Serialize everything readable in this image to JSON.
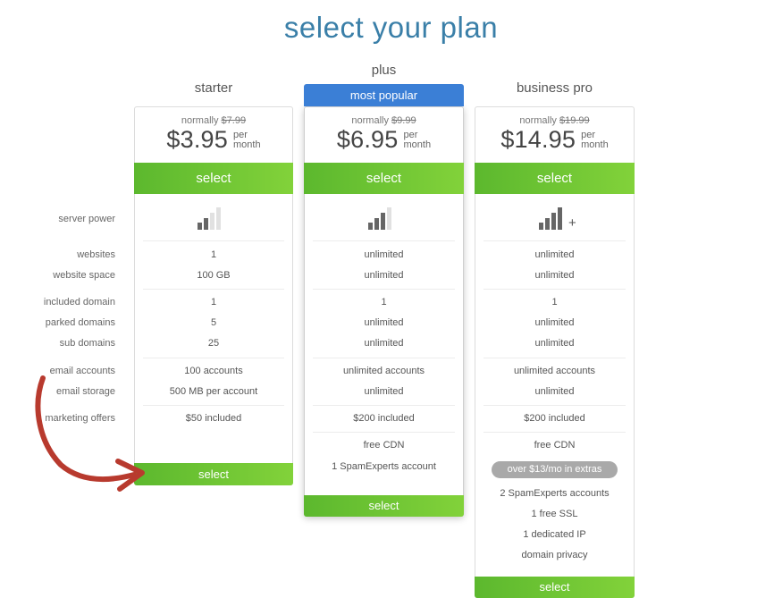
{
  "page": {
    "title": "select your plan"
  },
  "labels": {
    "server_power": "server power",
    "websites": "websites",
    "website_space": "website space",
    "included_domain": "included domain",
    "parked_domains": "parked domains",
    "sub_domains": "sub domains",
    "email_accounts": "email accounts",
    "email_storage": "email storage",
    "marketing_offers": "marketing offers"
  },
  "plans": [
    {
      "name": "starter",
      "normally_label": "normally",
      "original_price": "$7.99",
      "price": "$3.95",
      "per": "per",
      "month": "month",
      "select_top": "select",
      "select_bottom": "select",
      "server_power_level": 2,
      "websites": "1",
      "website_space": "100 GB",
      "included_domain": "1",
      "parked_domains": "5",
      "sub_domains": "25",
      "email_accounts": "100 accounts",
      "email_storage": "500 MB per account",
      "marketing_offers": "$50 included"
    },
    {
      "name": "plus",
      "badge": "most popular",
      "normally_label": "normally",
      "original_price": "$9.99",
      "price": "$6.95",
      "per": "per",
      "month": "month",
      "select_top": "select",
      "select_bottom": "select",
      "server_power_level": 3,
      "websites": "unlimited",
      "website_space": "unlimited",
      "included_domain": "1",
      "parked_domains": "unlimited",
      "sub_domains": "unlimited",
      "email_accounts": "unlimited accounts",
      "email_storage": "unlimited",
      "marketing_offers": "$200 included",
      "extra_1": "free CDN",
      "extra_2": "1 SpamExperts account"
    },
    {
      "name": "business pro",
      "normally_label": "normally",
      "original_price": "$19.99",
      "price": "$14.95",
      "per": "per",
      "month": "month",
      "select_top": "select",
      "select_bottom": "select",
      "server_power_level": 4,
      "server_power_plus": "+",
      "websites": "unlimited",
      "website_space": "unlimited",
      "included_domain": "1",
      "parked_domains": "unlimited",
      "sub_domains": "unlimited",
      "email_accounts": "unlimited accounts",
      "email_storage": "unlimited",
      "marketing_offers": "$200 included",
      "extra_1": "free CDN",
      "extras_badge": "over $13/mo in extras",
      "extra_2": "2 SpamExperts accounts",
      "extra_3": "1 free SSL",
      "extra_4": "1 dedicated IP",
      "extra_5": "domain privacy"
    }
  ],
  "colors": {
    "title": "#3a7fa8",
    "popular_banner": "#3b7fd6",
    "select_green_start": "#5cb82e",
    "select_green_end": "#82d23a",
    "arrow": "#b83a2e",
    "extras_pill": "#a9a9a9"
  }
}
